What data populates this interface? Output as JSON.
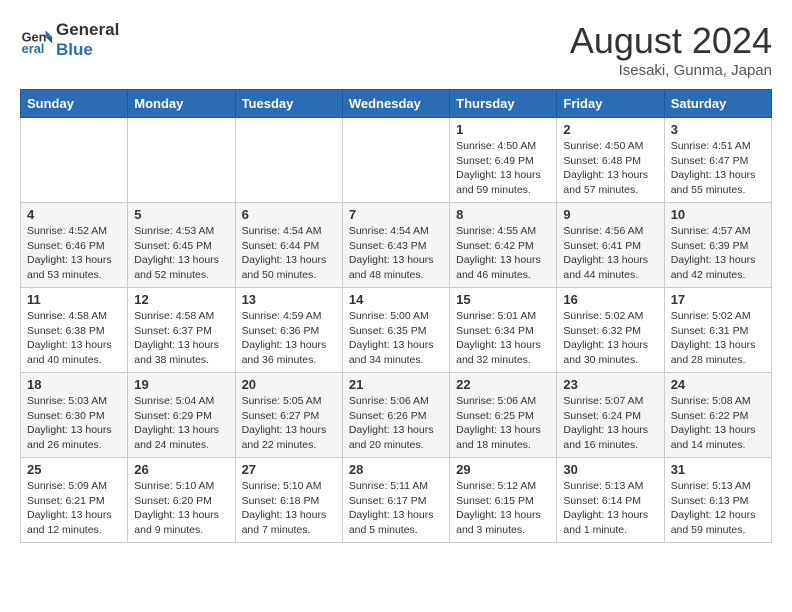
{
  "logo": {
    "line1": "General",
    "line2": "Blue"
  },
  "title": "August 2024",
  "location": "Isesaki, Gunma, Japan",
  "days_of_week": [
    "Sunday",
    "Monday",
    "Tuesday",
    "Wednesday",
    "Thursday",
    "Friday",
    "Saturday"
  ],
  "weeks": [
    [
      {
        "day": "",
        "content": ""
      },
      {
        "day": "",
        "content": ""
      },
      {
        "day": "",
        "content": ""
      },
      {
        "day": "",
        "content": ""
      },
      {
        "day": "1",
        "content": "Sunrise: 4:50 AM\nSunset: 6:49 PM\nDaylight: 13 hours\nand 59 minutes."
      },
      {
        "day": "2",
        "content": "Sunrise: 4:50 AM\nSunset: 6:48 PM\nDaylight: 13 hours\nand 57 minutes."
      },
      {
        "day": "3",
        "content": "Sunrise: 4:51 AM\nSunset: 6:47 PM\nDaylight: 13 hours\nand 55 minutes."
      }
    ],
    [
      {
        "day": "4",
        "content": "Sunrise: 4:52 AM\nSunset: 6:46 PM\nDaylight: 13 hours\nand 53 minutes."
      },
      {
        "day": "5",
        "content": "Sunrise: 4:53 AM\nSunset: 6:45 PM\nDaylight: 13 hours\nand 52 minutes."
      },
      {
        "day": "6",
        "content": "Sunrise: 4:54 AM\nSunset: 6:44 PM\nDaylight: 13 hours\nand 50 minutes."
      },
      {
        "day": "7",
        "content": "Sunrise: 4:54 AM\nSunset: 6:43 PM\nDaylight: 13 hours\nand 48 minutes."
      },
      {
        "day": "8",
        "content": "Sunrise: 4:55 AM\nSunset: 6:42 PM\nDaylight: 13 hours\nand 46 minutes."
      },
      {
        "day": "9",
        "content": "Sunrise: 4:56 AM\nSunset: 6:41 PM\nDaylight: 13 hours\nand 44 minutes."
      },
      {
        "day": "10",
        "content": "Sunrise: 4:57 AM\nSunset: 6:39 PM\nDaylight: 13 hours\nand 42 minutes."
      }
    ],
    [
      {
        "day": "11",
        "content": "Sunrise: 4:58 AM\nSunset: 6:38 PM\nDaylight: 13 hours\nand 40 minutes."
      },
      {
        "day": "12",
        "content": "Sunrise: 4:58 AM\nSunset: 6:37 PM\nDaylight: 13 hours\nand 38 minutes."
      },
      {
        "day": "13",
        "content": "Sunrise: 4:59 AM\nSunset: 6:36 PM\nDaylight: 13 hours\nand 36 minutes."
      },
      {
        "day": "14",
        "content": "Sunrise: 5:00 AM\nSunset: 6:35 PM\nDaylight: 13 hours\nand 34 minutes."
      },
      {
        "day": "15",
        "content": "Sunrise: 5:01 AM\nSunset: 6:34 PM\nDaylight: 13 hours\nand 32 minutes."
      },
      {
        "day": "16",
        "content": "Sunrise: 5:02 AM\nSunset: 6:32 PM\nDaylight: 13 hours\nand 30 minutes."
      },
      {
        "day": "17",
        "content": "Sunrise: 5:02 AM\nSunset: 6:31 PM\nDaylight: 13 hours\nand 28 minutes."
      }
    ],
    [
      {
        "day": "18",
        "content": "Sunrise: 5:03 AM\nSunset: 6:30 PM\nDaylight: 13 hours\nand 26 minutes."
      },
      {
        "day": "19",
        "content": "Sunrise: 5:04 AM\nSunset: 6:29 PM\nDaylight: 13 hours\nand 24 minutes."
      },
      {
        "day": "20",
        "content": "Sunrise: 5:05 AM\nSunset: 6:27 PM\nDaylight: 13 hours\nand 22 minutes."
      },
      {
        "day": "21",
        "content": "Sunrise: 5:06 AM\nSunset: 6:26 PM\nDaylight: 13 hours\nand 20 minutes."
      },
      {
        "day": "22",
        "content": "Sunrise: 5:06 AM\nSunset: 6:25 PM\nDaylight: 13 hours\nand 18 minutes."
      },
      {
        "day": "23",
        "content": "Sunrise: 5:07 AM\nSunset: 6:24 PM\nDaylight: 13 hours\nand 16 minutes."
      },
      {
        "day": "24",
        "content": "Sunrise: 5:08 AM\nSunset: 6:22 PM\nDaylight: 13 hours\nand 14 minutes."
      }
    ],
    [
      {
        "day": "25",
        "content": "Sunrise: 5:09 AM\nSunset: 6:21 PM\nDaylight: 13 hours\nand 12 minutes."
      },
      {
        "day": "26",
        "content": "Sunrise: 5:10 AM\nSunset: 6:20 PM\nDaylight: 13 hours\nand 9 minutes."
      },
      {
        "day": "27",
        "content": "Sunrise: 5:10 AM\nSunset: 6:18 PM\nDaylight: 13 hours\nand 7 minutes."
      },
      {
        "day": "28",
        "content": "Sunrise: 5:11 AM\nSunset: 6:17 PM\nDaylight: 13 hours\nand 5 minutes."
      },
      {
        "day": "29",
        "content": "Sunrise: 5:12 AM\nSunset: 6:15 PM\nDaylight: 13 hours\nand 3 minutes."
      },
      {
        "day": "30",
        "content": "Sunrise: 5:13 AM\nSunset: 6:14 PM\nDaylight: 13 hours\nand 1 minute."
      },
      {
        "day": "31",
        "content": "Sunrise: 5:13 AM\nSunset: 6:13 PM\nDaylight: 12 hours\nand 59 minutes."
      }
    ]
  ]
}
